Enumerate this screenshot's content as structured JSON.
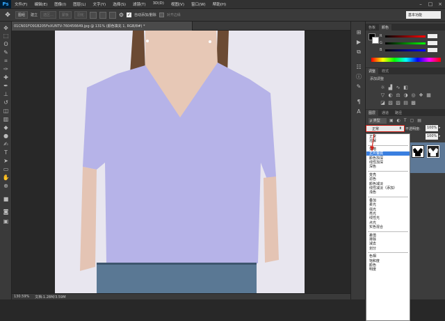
{
  "app": {
    "logo": "Ps"
  },
  "menubar": {
    "items": [
      "文件(F)",
      "编辑(E)",
      "图像(I)",
      "图层(L)",
      "文字(Y)",
      "选择(S)",
      "滤镜(T)",
      "3D(D)",
      "视图(V)",
      "窗口(W)",
      "帮助(H)"
    ],
    "window_controls": [
      "–",
      "□",
      "×"
    ]
  },
  "options": {
    "tool_icon": "move-tool-icon",
    "layer_select": "图组",
    "auto_select_label": "自动选择:",
    "confirm_label": "建立",
    "btn_selection": "选区...",
    "btn_refine": "蒙板",
    "btn_edge": "羽化",
    "auto_add_label": "自动添加/删除",
    "align_edges_label": "对齐边缘",
    "workspace": "基本功能"
  },
  "document": {
    "tab_title": "01CN01FO91B205FoXUNTV-760456649.jpg @ 131% (颜色填充 1, RGB/8#) *",
    "tab_close": "×"
  },
  "status": {
    "zoom": "130.59%",
    "doc_info": "文档:1.28M/3.59M"
  },
  "panels": {
    "color_tabs": [
      "色板",
      "颜色"
    ],
    "rgb_labels": [
      "R",
      "G",
      "B"
    ],
    "adjust_tabs": [
      "调整",
      "样式"
    ],
    "adjust_title": "添加调整",
    "layers_tabs": [
      "图层",
      "通道",
      "路径"
    ],
    "layer_type_label": "ρ 类型",
    "blend_mode_value": "正常",
    "opacity_label": "不透明度:",
    "opacity_value": "100%",
    "fill_value": "100%"
  },
  "blend_modes": {
    "groups": [
      [
        "正常",
        "溶解"
      ],
      [
        "变暗",
        "正片叠底",
        "颜色加深",
        "线性加深",
        "深色"
      ],
      [
        "变亮",
        "滤色",
        "颜色减淡",
        "线性减淡（添加）",
        "浅色"
      ],
      [
        "叠加",
        "柔光",
        "强光",
        "亮光",
        "线性光",
        "点光",
        "实色混合"
      ],
      [
        "差值",
        "排除",
        "减去",
        "划分"
      ],
      [
        "色相",
        "饱和度",
        "颜色",
        "明度"
      ]
    ],
    "selected": "正片叠底"
  },
  "colors": {
    "shirt": "#b6b3e8",
    "accent_red": "#d0221a",
    "selected_item": "#3a7fe0"
  }
}
